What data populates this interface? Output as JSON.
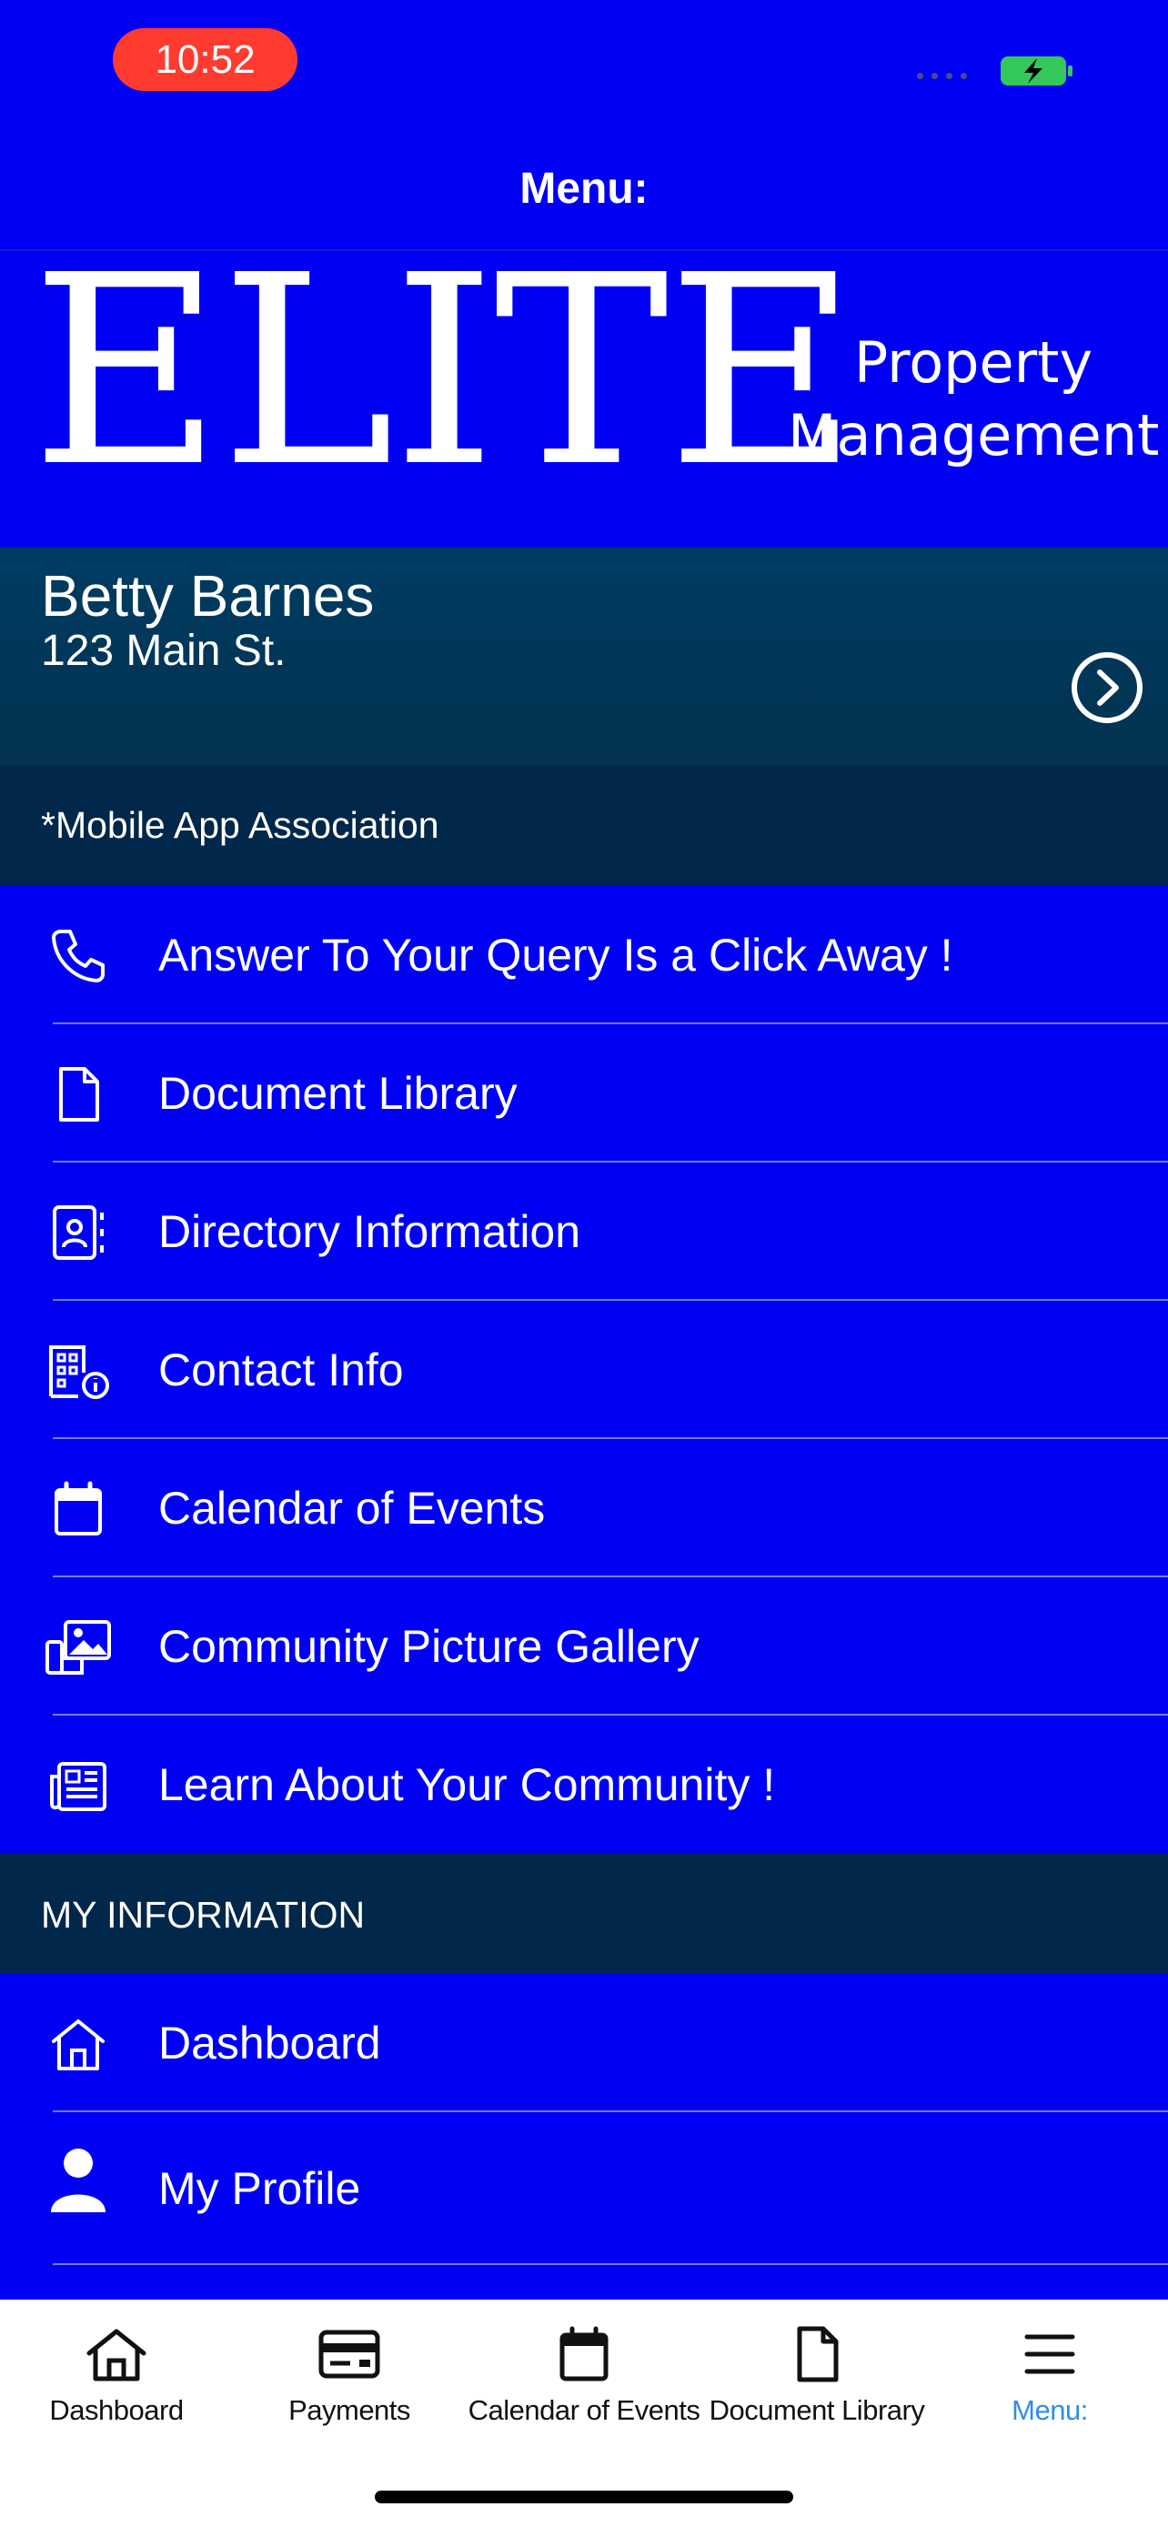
{
  "status_bar": {
    "time": "10:52",
    "accent": "#FF3B30",
    "battery_color": "#34C759"
  },
  "header": {
    "title": "Menu:"
  },
  "logo": {
    "main": "ELITE",
    "line1": "Property",
    "line2": "Management"
  },
  "profile": {
    "name": "Betty Barnes",
    "address": "123 Main St.",
    "association": "*Mobile App Association"
  },
  "menu": {
    "items": [
      {
        "label": "Answer To Your Query Is a Click Away !",
        "icon": "phone-icon"
      },
      {
        "label": "Document Library",
        "icon": "document-icon"
      },
      {
        "label": "Directory Information",
        "icon": "contact-card-icon"
      },
      {
        "label": "Contact Info",
        "icon": "building-info-icon"
      },
      {
        "label": "Calendar of Events",
        "icon": "calendar-icon"
      },
      {
        "label": "Community Picture Gallery",
        "icon": "gallery-icon"
      },
      {
        "label": "Learn About Your Community !",
        "icon": "newspaper-icon"
      }
    ],
    "section_title": "MY INFORMATION",
    "my_info_items": [
      {
        "label": "Dashboard",
        "icon": "home-icon"
      },
      {
        "label": "My Profile",
        "icon": "person-icon"
      }
    ]
  },
  "tab_bar": {
    "items": [
      {
        "label": "Dashboard",
        "icon": "home-icon"
      },
      {
        "label": "Payments",
        "icon": "payment-card-icon"
      },
      {
        "label": "Calendar of Events",
        "icon": "calendar-icon"
      },
      {
        "label": "Document Library",
        "icon": "document-icon"
      },
      {
        "label": "Menu:",
        "icon": "hamburger-menu-icon",
        "active": true
      }
    ],
    "active_color": "#2d8ee8"
  },
  "colors": {
    "background": "#0000F5",
    "card": "#003c63",
    "section": "#01274a"
  }
}
